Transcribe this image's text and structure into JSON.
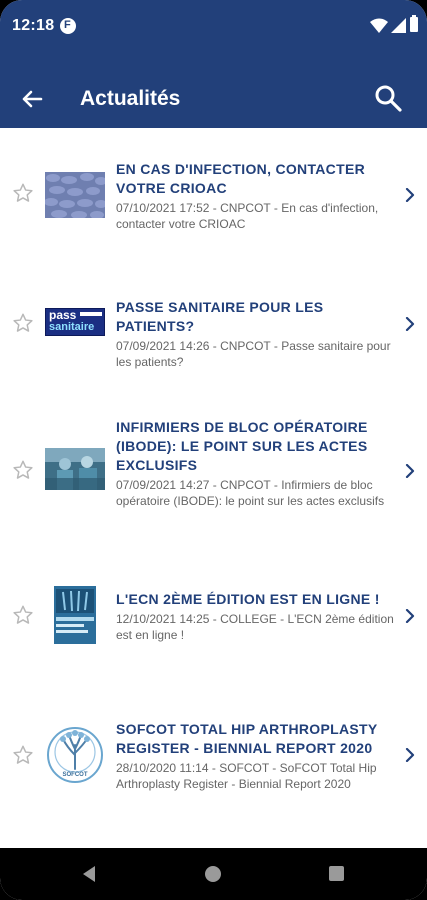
{
  "status_bar": {
    "time": "12:18"
  },
  "app_bar": {
    "title": "Actualités"
  },
  "news": [
    {
      "headline": "EN CAS D'INFECTION, CONTACTER VOTRE CRIOAC",
      "meta": "07/10/2021 17:52 - CNPCOT - En cas d'infection, contacter votre CRIOAC"
    },
    {
      "headline": "PASSE SANITAIRE POUR LES PATIENTS?",
      "meta": "07/09/2021 14:26 - CNPCOT - Passe sanitaire pour les patients?",
      "thumb_text_1": "pass",
      "thumb_text_2": "sanitaire"
    },
    {
      "headline": "INFIRMIERS DE BLOC OPÉRATOIRE (IBODE):  LE POINT SUR LES ACTES EXCLUSIFS",
      "meta": "07/09/2021 14:27 - CNPCOT - Infirmiers de bloc opératoire (IBODE):  le point sur les actes exclusifs"
    },
    {
      "headline": "L'ECN 2ÈME ÉDITION EST EN LIGNE !",
      "meta": "12/10/2021 14:25 - COLLEGE - L'ECN 2ème édition est en ligne !"
    },
    {
      "headline": "SOFCOT TOTAL HIP ARTHROPLASTY REGISTER - BIENNIAL REPORT 2020",
      "meta": "28/10/2020 11:14 - SOFCOT - SoFCOT Total Hip Arthroplasty Register - Biennial Report 2020",
      "thumb_text_1": "SOFCOT"
    }
  ],
  "colors": {
    "primary": "#22407a",
    "meta_text": "#666666",
    "star": "#b8b8b8"
  },
  "icons": [
    "back-arrow-icon",
    "search-icon",
    "star-outline-icon",
    "chevron-right-icon",
    "nav-back-icon",
    "nav-home-icon",
    "nav-recents-icon"
  ]
}
